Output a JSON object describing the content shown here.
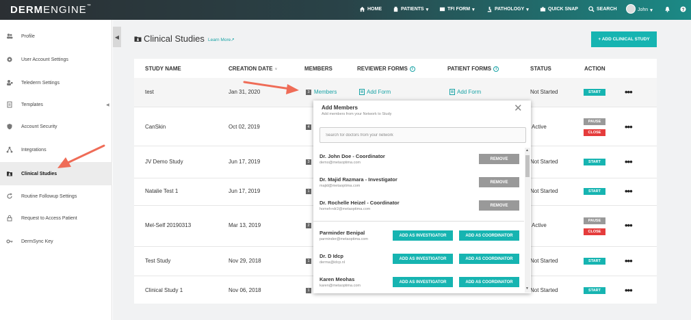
{
  "brand": {
    "logo_bold": "DERM",
    "logo_light": "ENGINE",
    "logo_tm": "™"
  },
  "nav": {
    "home": "HOME",
    "patients": "PATIENTS",
    "tfi_form": "TFI FORM",
    "pathology": "PATHOLOGY",
    "quick_snap": "QUICK SNAP",
    "search": "SEARCH",
    "user": "John"
  },
  "sidebar": {
    "items": [
      {
        "label": "Profile",
        "icon": "users-icon"
      },
      {
        "label": "User Account Settings",
        "icon": "gear-icon"
      },
      {
        "label": "Telederm Settings",
        "icon": "user-badge-icon"
      },
      {
        "label": "Templates",
        "icon": "document-icon"
      },
      {
        "label": "Account Security",
        "icon": "shield-icon"
      },
      {
        "label": "Integrations",
        "icon": "share-icon"
      },
      {
        "label": "Clinical Studies",
        "icon": "folder-user-icon"
      },
      {
        "label": "Routine Followup Settings",
        "icon": "refresh-icon"
      },
      {
        "label": "Request to Access Patient",
        "icon": "lock-icon"
      },
      {
        "label": "DermSync Key",
        "icon": "key-icon"
      }
    ]
  },
  "page": {
    "title": "Clinical Studies",
    "learn_more": "Learn More",
    "add_button": "+ ADD CLINICAL STUDY"
  },
  "table": {
    "headers": {
      "study_name": "STUDY NAME",
      "creation_date": "CREATION DATE",
      "sort_indicator": "∨",
      "members": "MEMBERS",
      "reviewer_forms": "REVIEWER FORMS",
      "patient_forms": "PATIENT FORMS",
      "status": "STATUS",
      "action": "ACTION"
    },
    "members_link": "Members",
    "add_form": "Add Form",
    "start": "START",
    "pause": "PAUSE",
    "close": "CLOSE",
    "more": "•••",
    "rows": [
      {
        "name": "test",
        "date": "Jan 31, 2020",
        "members": "3",
        "status": "Not Started"
      },
      {
        "name": "CanSkin",
        "date": "Oct 02, 2019",
        "members": "4",
        "status": "Active"
      },
      {
        "name": "JV Demo Study",
        "date": "Jun 17, 2019",
        "members": "3",
        "status": "Not Started"
      },
      {
        "name": "Natalie Test 1",
        "date": "Jun 17, 2019",
        "members": "1",
        "status": "Not Started"
      },
      {
        "name": "Mel-Self 20190313",
        "date": "Mar 13, 2019",
        "members": "2",
        "status": "Active"
      },
      {
        "name": "Test Study",
        "date": "Nov 29, 2018",
        "members": "1",
        "status": "Not Started"
      },
      {
        "name": "Clinical Study 1",
        "date": "Nov 06, 2018",
        "members": "1",
        "status": "Not Started"
      }
    ]
  },
  "popup": {
    "title": "Add Members",
    "subtitle": "Add members from your Network to Study",
    "search_placeholder": "Search for doctors from your network",
    "remove": "REMOVE",
    "add_investigator": "ADD AS INVESTIGATOR",
    "add_coordinator": "ADD AS COORDINATOR",
    "members": [
      {
        "name": "Dr. John Doe - Coordinator",
        "email": "demo@metaoptima.com"
      },
      {
        "name": "Dr. Majid Razmara - Investigator",
        "email": "majid@metaoptima.com"
      },
      {
        "name": "Dr. Rochelle Heizel - Coordinator",
        "email": "homeh+dr2@metaoptima.com"
      }
    ],
    "network": [
      {
        "name": "Parminder Benipal",
        "email": "parminder@metaoptima.com"
      },
      {
        "name": "Dr. D Idcp",
        "email": "derma@idcp.nl"
      },
      {
        "name": "Karen Meohas",
        "email": "karen@metaoptima.com"
      }
    ]
  },
  "colors": {
    "accent": "#16b4b1",
    "danger": "#e53c3c",
    "arrow": "#ef6c57"
  }
}
